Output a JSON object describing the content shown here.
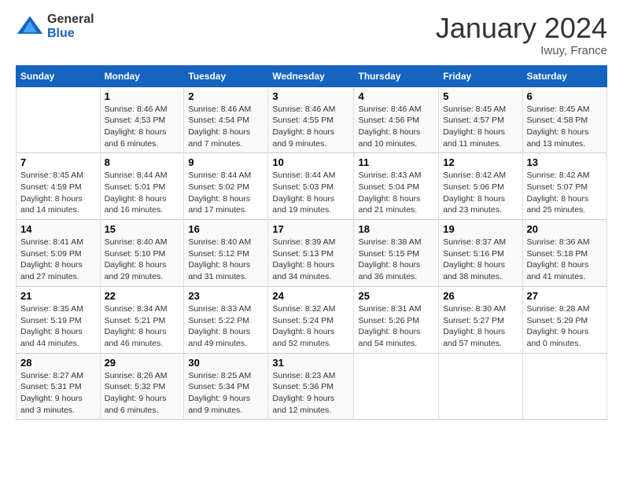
{
  "logo": {
    "general": "General",
    "blue": "Blue"
  },
  "title": "January 2024",
  "location": "Iwuy, France",
  "days_header": [
    "Sunday",
    "Monday",
    "Tuesday",
    "Wednesday",
    "Thursday",
    "Friday",
    "Saturday"
  ],
  "weeks": [
    [
      {
        "day": "",
        "content": ""
      },
      {
        "day": "1",
        "content": "Sunrise: 8:46 AM\nSunset: 4:53 PM\nDaylight: 8 hours\nand 6 minutes."
      },
      {
        "day": "2",
        "content": "Sunrise: 8:46 AM\nSunset: 4:54 PM\nDaylight: 8 hours\nand 7 minutes."
      },
      {
        "day": "3",
        "content": "Sunrise: 8:46 AM\nSunset: 4:55 PM\nDaylight: 8 hours\nand 9 minutes."
      },
      {
        "day": "4",
        "content": "Sunrise: 8:46 AM\nSunset: 4:56 PM\nDaylight: 8 hours\nand 10 minutes."
      },
      {
        "day": "5",
        "content": "Sunrise: 8:45 AM\nSunset: 4:57 PM\nDaylight: 8 hours\nand 11 minutes."
      },
      {
        "day": "6",
        "content": "Sunrise: 8:45 AM\nSunset: 4:58 PM\nDaylight: 8 hours\nand 13 minutes."
      }
    ],
    [
      {
        "day": "7",
        "content": "Sunrise: 8:45 AM\nSunset: 4:59 PM\nDaylight: 8 hours\nand 14 minutes."
      },
      {
        "day": "8",
        "content": "Sunrise: 8:44 AM\nSunset: 5:01 PM\nDaylight: 8 hours\nand 16 minutes."
      },
      {
        "day": "9",
        "content": "Sunrise: 8:44 AM\nSunset: 5:02 PM\nDaylight: 8 hours\nand 17 minutes."
      },
      {
        "day": "10",
        "content": "Sunrise: 8:44 AM\nSunset: 5:03 PM\nDaylight: 8 hours\nand 19 minutes."
      },
      {
        "day": "11",
        "content": "Sunrise: 8:43 AM\nSunset: 5:04 PM\nDaylight: 8 hours\nand 21 minutes."
      },
      {
        "day": "12",
        "content": "Sunrise: 8:42 AM\nSunset: 5:06 PM\nDaylight: 8 hours\nand 23 minutes."
      },
      {
        "day": "13",
        "content": "Sunrise: 8:42 AM\nSunset: 5:07 PM\nDaylight: 8 hours\nand 25 minutes."
      }
    ],
    [
      {
        "day": "14",
        "content": "Sunrise: 8:41 AM\nSunset: 5:09 PM\nDaylight: 8 hours\nand 27 minutes."
      },
      {
        "day": "15",
        "content": "Sunrise: 8:40 AM\nSunset: 5:10 PM\nDaylight: 8 hours\nand 29 minutes."
      },
      {
        "day": "16",
        "content": "Sunrise: 8:40 AM\nSunset: 5:12 PM\nDaylight: 8 hours\nand 31 minutes."
      },
      {
        "day": "17",
        "content": "Sunrise: 8:39 AM\nSunset: 5:13 PM\nDaylight: 8 hours\nand 34 minutes."
      },
      {
        "day": "18",
        "content": "Sunrise: 8:38 AM\nSunset: 5:15 PM\nDaylight: 8 hours\nand 36 minutes."
      },
      {
        "day": "19",
        "content": "Sunrise: 8:37 AM\nSunset: 5:16 PM\nDaylight: 8 hours\nand 38 minutes."
      },
      {
        "day": "20",
        "content": "Sunrise: 8:36 AM\nSunset: 5:18 PM\nDaylight: 8 hours\nand 41 minutes."
      }
    ],
    [
      {
        "day": "21",
        "content": "Sunrise: 8:35 AM\nSunset: 5:19 PM\nDaylight: 8 hours\nand 44 minutes."
      },
      {
        "day": "22",
        "content": "Sunrise: 8:34 AM\nSunset: 5:21 PM\nDaylight: 8 hours\nand 46 minutes."
      },
      {
        "day": "23",
        "content": "Sunrise: 8:33 AM\nSunset: 5:22 PM\nDaylight: 8 hours\nand 49 minutes."
      },
      {
        "day": "24",
        "content": "Sunrise: 8:32 AM\nSunset: 5:24 PM\nDaylight: 8 hours\nand 52 minutes."
      },
      {
        "day": "25",
        "content": "Sunrise: 8:31 AM\nSunset: 5:26 PM\nDaylight: 8 hours\nand 54 minutes."
      },
      {
        "day": "26",
        "content": "Sunrise: 8:30 AM\nSunset: 5:27 PM\nDaylight: 8 hours\nand 57 minutes."
      },
      {
        "day": "27",
        "content": "Sunrise: 8:28 AM\nSunset: 5:29 PM\nDaylight: 9 hours\nand 0 minutes."
      }
    ],
    [
      {
        "day": "28",
        "content": "Sunrise: 8:27 AM\nSunset: 5:31 PM\nDaylight: 9 hours\nand 3 minutes."
      },
      {
        "day": "29",
        "content": "Sunrise: 8:26 AM\nSunset: 5:32 PM\nDaylight: 9 hours\nand 6 minutes."
      },
      {
        "day": "30",
        "content": "Sunrise: 8:25 AM\nSunset: 5:34 PM\nDaylight: 9 hours\nand 9 minutes."
      },
      {
        "day": "31",
        "content": "Sunrise: 8:23 AM\nSunset: 5:36 PM\nDaylight: 9 hours\nand 12 minutes."
      },
      {
        "day": "",
        "content": ""
      },
      {
        "day": "",
        "content": ""
      },
      {
        "day": "",
        "content": ""
      }
    ]
  ]
}
